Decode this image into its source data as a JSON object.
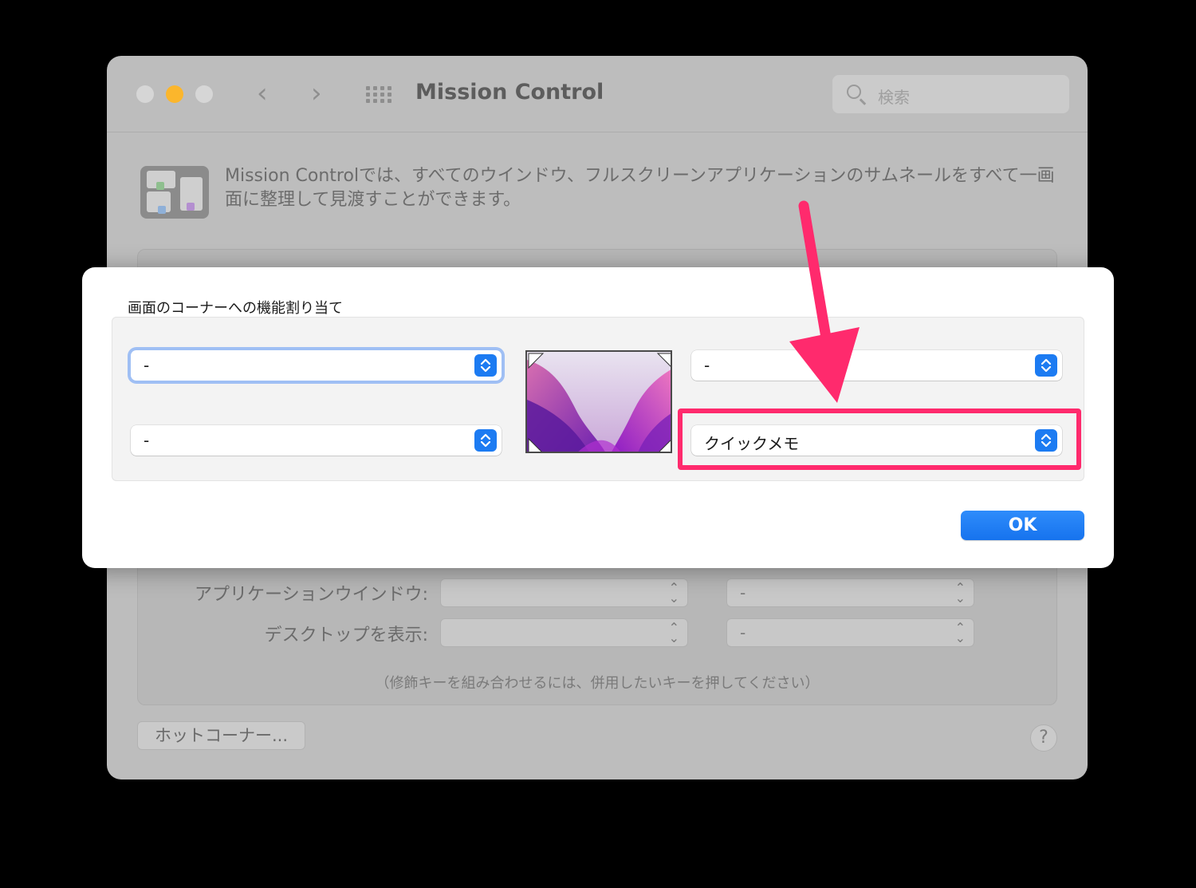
{
  "window": {
    "title": "Mission Control",
    "search_placeholder": "検索",
    "description": "Mission Controlでは、すべてのウインドウ、フルスクリーンアプリケーションのサムネールをすべて一画面に整理して見渡すことができます。",
    "rows": [
      {
        "label": "アプリケーションウインドウ:",
        "left_value": "",
        "right_value": "-"
      },
      {
        "label": "デスクトップを表示:",
        "left_value": "",
        "right_value": "-"
      }
    ],
    "hint": "（修飾キーを組み合わせるには、併用したいキーを押してください）",
    "hot_corners_button": "ホットコーナー...",
    "help_button": "?"
  },
  "sheet": {
    "title": "画面のコーナーへの機能割り当て",
    "top_left": "-",
    "bottom_left": "-",
    "top_right": "-",
    "bottom_right": "クイックメモ",
    "ok_button": "OK"
  },
  "icons": {
    "nav_back": "chevron-left-icon",
    "nav_forward": "chevron-right-icon",
    "grid": "show-all-grid-icon",
    "search": "search-icon",
    "stepper": "up-down-chevron-icon"
  },
  "colors": {
    "accent": "#1c7bf2",
    "annotation": "#ff2a6d",
    "minimize_light": "#fbb62c"
  }
}
